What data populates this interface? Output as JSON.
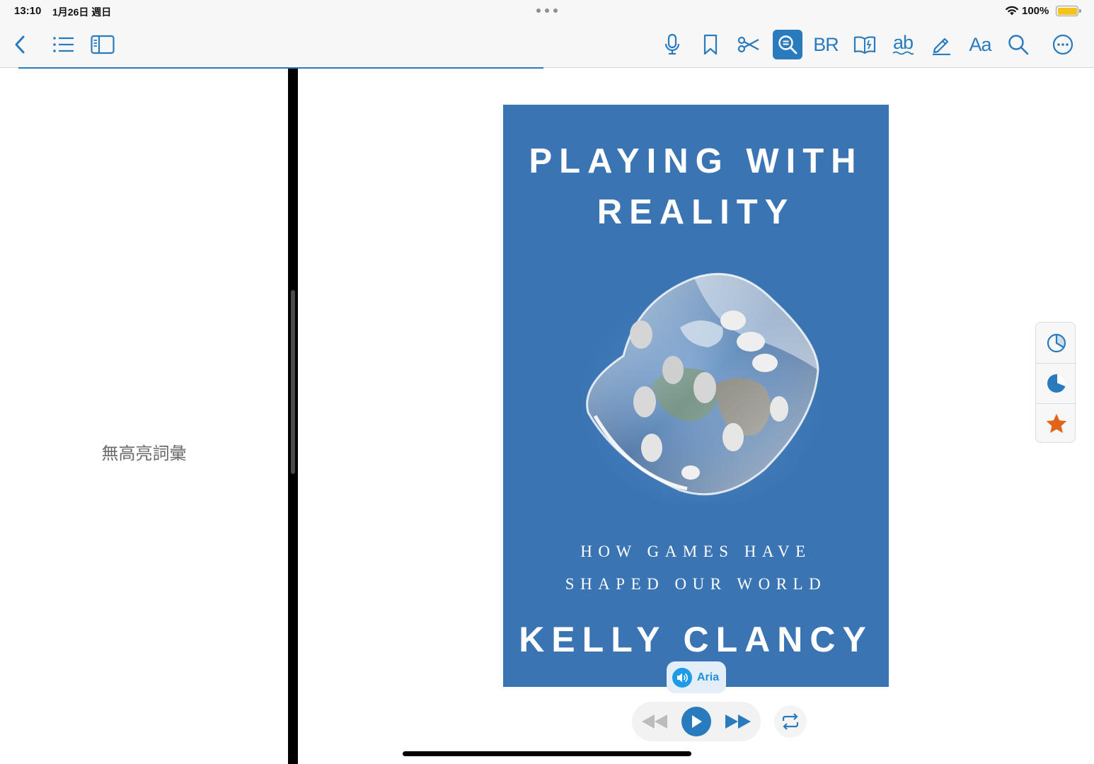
{
  "status_bar": {
    "time": "13:10",
    "date": "1月26日 週日",
    "battery_percent": "100%",
    "battery_level": 1.0
  },
  "toolbar": {
    "left_icons": [
      "chevron-left-icon",
      "list-icon",
      "sidebar-icon"
    ],
    "right_icons": [
      "microphone-icon",
      "bookmark-icon",
      "scissors-icon",
      "zoom-search-icon",
      "bionic-reading-icon",
      "dictionary-icon",
      "translate-icon",
      "highlighter-icon",
      "font-settings-icon",
      "search-icon",
      "more-icon"
    ],
    "bionic_label": "BR",
    "ab_label": "ab",
    "font_label": "Aa",
    "active_tool": "zoom-search-icon",
    "accent_color": "#2a7bbd",
    "reading_progress": 0.48
  },
  "left_panel": {
    "empty_message": "無高亮詞彙"
  },
  "book": {
    "title_line1": "PLAYING WITH",
    "title_line2": "REALITY",
    "subtitle_line1": "HOW GAMES HAVE",
    "subtitle_line2": "SHAPED OUR WORLD",
    "author": "KELLY CLANCY",
    "cover_color": "#3a74b3"
  },
  "tts": {
    "voice_label": "Aria",
    "controls": [
      "rewind-icon",
      "play-icon",
      "fast-forward-icon",
      "repeat-icon"
    ]
  },
  "side_tools": [
    "pie-chart-outline-icon",
    "pie-chart-filled-icon",
    "star-icon"
  ]
}
